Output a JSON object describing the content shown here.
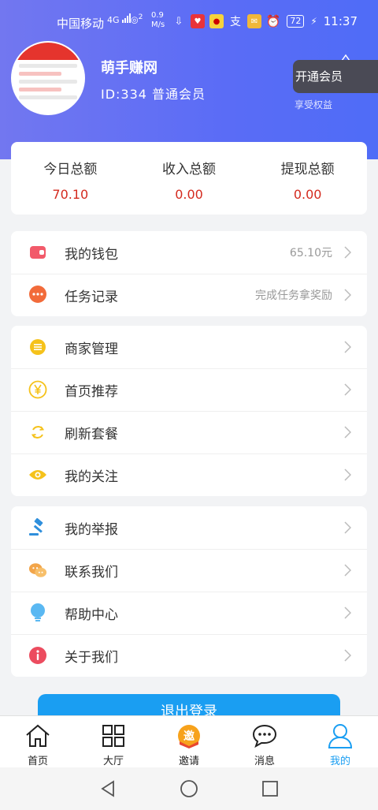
{
  "status_bar": {
    "carrier": "中国移动",
    "network": "4G",
    "wifi_label": "2",
    "speed_value": "0.9",
    "speed_unit": "M/s",
    "battery": "72",
    "time": "11:37"
  },
  "profile": {
    "name": "萌手赚网",
    "id_text": "ID:334 普通会员",
    "vip_button": "开通会员",
    "vip_subtitle": "享受权益"
  },
  "stats": [
    {
      "label": "今日总额",
      "value": "70.10"
    },
    {
      "label": "收入总额",
      "value": "0.00"
    },
    {
      "label": "提现总额",
      "value": "0.00"
    }
  ],
  "group1": [
    {
      "label": "我的钱包",
      "right": "65.10元",
      "icon": "wallet-icon"
    },
    {
      "label": "任务记录",
      "right": "完成任务拿奖励",
      "icon": "chat-bubble-icon"
    }
  ],
  "group2": [
    {
      "label": "商家管理",
      "icon": "list-icon"
    },
    {
      "label": "首页推荐",
      "icon": "yen-icon"
    },
    {
      "label": "刷新套餐",
      "icon": "refresh-icon"
    },
    {
      "label": "我的关注",
      "icon": "eye-icon"
    }
  ],
  "group3": [
    {
      "label": "我的举报",
      "icon": "gavel-icon"
    },
    {
      "label": "联系我们",
      "icon": "wechat-icon"
    },
    {
      "label": "帮助中心",
      "icon": "lightbulb-icon"
    },
    {
      "label": "关于我们",
      "icon": "info-icon"
    }
  ],
  "logout_label": "退出登录",
  "tabs": [
    {
      "label": "首页",
      "icon": "home-icon"
    },
    {
      "label": "大厅",
      "icon": "grid-icon"
    },
    {
      "label": "邀请",
      "icon": "invite-icon",
      "badge": "邀"
    },
    {
      "label": "消息",
      "icon": "message-icon"
    },
    {
      "label": "我的",
      "icon": "user-icon",
      "active": true
    }
  ],
  "colors": {
    "accent": "#1a9ef2",
    "value_red": "#d42a1e",
    "header_start": "#7277f0",
    "header_end": "#4f6cf7"
  }
}
